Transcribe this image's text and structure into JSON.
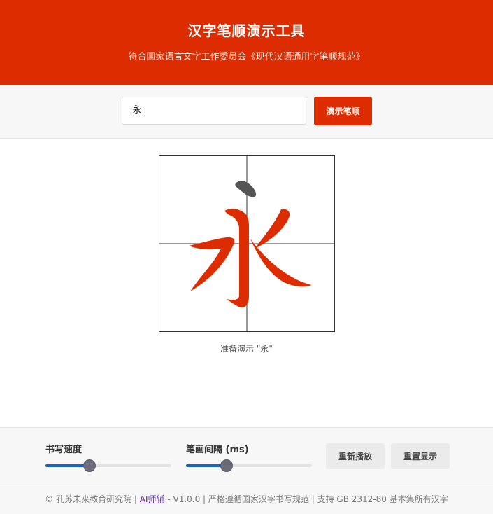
{
  "header": {
    "title": "汉字笔顺演示工具",
    "subtitle": "符合国家语言文字工作委员会《现代汉语通用字笔顺规范》"
  },
  "input": {
    "value": "永",
    "button_label": "演示笔顺"
  },
  "canvas": {
    "character": "永",
    "completed_stroke_color": "#dd2c00",
    "current_stroke_color": "#555555",
    "status_text": "准备演示 \"永\""
  },
  "controls": {
    "speed_label": "书写速度",
    "speed_value": 0.35,
    "interval_label": "笔画间隔 (ms)",
    "interval_value": 0.32,
    "replay_label": "重新播放",
    "reset_label": "重置显示"
  },
  "footer": {
    "prefix": "© 孔苏未来教育研究院 |",
    "link_text": "AI师辅",
    "suffix": "- V1.0.0 | 严格遵循国家汉字书写规范 | 支持 GB 2312-80 基本集所有汉字"
  },
  "colors": {
    "brand": "#dd2c00",
    "slider_fill": "#1565c0"
  }
}
